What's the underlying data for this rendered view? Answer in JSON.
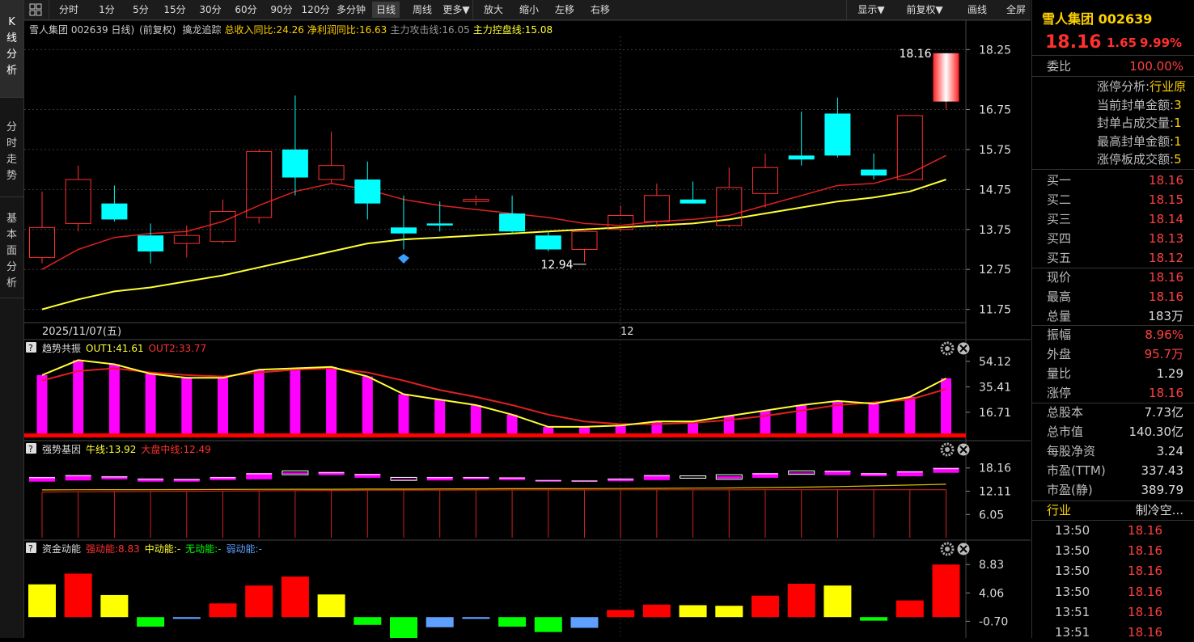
{
  "left_nav": [
    {
      "label": "K线分析",
      "chars": [
        "K",
        "线",
        "分",
        "析"
      ]
    },
    {
      "label": "分时走势",
      "chars": [
        "分",
        "时",
        "走",
        "势"
      ]
    },
    {
      "label": "基本面分析",
      "chars": [
        "基",
        "本",
        "面",
        "分",
        "析"
      ]
    }
  ],
  "toolbar": {
    "periods": [
      "分时",
      "1分",
      "5分",
      "15分",
      "30分",
      "60分",
      "90分",
      "120分",
      "多分钟",
      "日线",
      "周线",
      "更多▼"
    ],
    "active_period": "日线",
    "actions": [
      "放大",
      "缩小",
      "左移",
      "右移"
    ],
    "right_actions": [
      "显示▼",
      "前复权▼",
      "画线",
      "全屏"
    ]
  },
  "main_chart": {
    "title": "雪人集团 002639 日线)",
    "adjust": "(前复权)",
    "indicator": "擒龙追踪",
    "rev_label": "总收入同比:24.26",
    "profit_label": "净利润同比:16.63",
    "attack_label": "主力攻击线:16.05",
    "control_label": "主力控盘线:15.08",
    "y_ticks": [
      "18.25",
      "16.75",
      "15.75",
      "14.75",
      "13.75",
      "12.75",
      "11.75"
    ],
    "date_label": "2025/11/07(五)",
    "month_label": "12",
    "high_label": "18.16",
    "low_label": "12.94"
  },
  "chart_data": [
    {
      "type": "candlestick",
      "y_range": [
        11.5,
        18.5
      ],
      "candles": [
        {
          "o": 13.05,
          "c": 13.8,
          "h": 14.7,
          "l": 12.9,
          "up": true
        },
        {
          "o": 13.9,
          "c": 15.0,
          "h": 15.35,
          "l": 13.7,
          "up": true
        },
        {
          "o": 14.4,
          "c": 14.0,
          "h": 14.85,
          "l": 13.95,
          "up": false
        },
        {
          "o": 13.6,
          "c": 13.2,
          "h": 13.9,
          "l": 12.9,
          "up": false
        },
        {
          "o": 13.4,
          "c": 13.6,
          "h": 13.85,
          "l": 13.05,
          "up": true
        },
        {
          "o": 13.45,
          "c": 14.2,
          "h": 14.5,
          "l": 13.4,
          "up": true
        },
        {
          "o": 14.05,
          "c": 15.7,
          "h": 15.75,
          "l": 13.9,
          "up": true
        },
        {
          "o": 15.75,
          "c": 15.05,
          "h": 17.1,
          "l": 14.6,
          "up": false
        },
        {
          "o": 15.0,
          "c": 15.35,
          "h": 16.2,
          "l": 14.9,
          "up": true
        },
        {
          "o": 15.0,
          "c": 14.4,
          "h": 15.45,
          "l": 14.0,
          "up": false
        },
        {
          "o": 13.8,
          "c": 13.65,
          "h": 14.6,
          "l": 13.25,
          "up": false
        },
        {
          "o": 13.85,
          "c": 13.9,
          "h": 14.45,
          "l": 13.7,
          "up": false
        },
        {
          "o": 14.5,
          "c": 14.45,
          "h": 14.6,
          "l": 14.35,
          "up": true
        },
        {
          "o": 14.15,
          "c": 13.7,
          "h": 14.6,
          "l": 13.65,
          "up": false
        },
        {
          "o": 13.6,
          "c": 13.25,
          "h": 13.7,
          "l": 13.2,
          "up": false
        },
        {
          "o": 13.25,
          "c": 13.7,
          "h": 13.75,
          "l": 12.94,
          "up": true
        },
        {
          "o": 13.75,
          "c": 14.1,
          "h": 14.35,
          "l": 13.7,
          "up": true
        },
        {
          "o": 13.95,
          "c": 14.6,
          "h": 14.9,
          "l": 13.8,
          "up": true
        },
        {
          "o": 14.5,
          "c": 14.4,
          "h": 14.95,
          "l": 14.4,
          "up": false
        },
        {
          "o": 13.85,
          "c": 14.8,
          "h": 15.3,
          "l": 13.8,
          "up": true
        },
        {
          "o": 14.65,
          "c": 15.3,
          "h": 15.65,
          "l": 14.3,
          "up": true
        },
        {
          "o": 15.6,
          "c": 15.5,
          "h": 16.7,
          "l": 15.35,
          "up": false
        },
        {
          "o": 16.65,
          "c": 15.6,
          "h": 17.05,
          "l": 15.55,
          "up": false
        },
        {
          "o": 15.25,
          "c": 15.1,
          "h": 15.65,
          "l": 15.0,
          "up": false
        },
        {
          "o": 15.0,
          "c": 16.6,
          "h": 16.6,
          "l": 15.0,
          "up": true
        },
        {
          "o": 16.95,
          "c": 18.16,
          "h": 18.16,
          "l": 16.75,
          "up": true
        }
      ],
      "attack_line": [
        12.75,
        13.25,
        13.55,
        13.65,
        13.7,
        13.95,
        14.35,
        14.7,
        14.9,
        14.75,
        14.5,
        14.35,
        14.25,
        14.15,
        14.05,
        13.9,
        13.85,
        13.95,
        14.0,
        14.1,
        14.35,
        14.6,
        14.85,
        14.9,
        15.15,
        15.6
      ],
      "control_line": [
        11.75,
        12.0,
        12.2,
        12.3,
        12.45,
        12.6,
        12.8,
        13.0,
        13.2,
        13.4,
        13.5,
        13.55,
        13.6,
        13.65,
        13.7,
        13.75,
        13.8,
        13.85,
        13.9,
        14.0,
        14.15,
        14.3,
        14.45,
        14.55,
        14.7,
        15.0
      ]
    },
    {
      "type": "bar",
      "title": "趋势共振",
      "out1_label": "OUT1:41.61",
      "out2_label": "OUT2:33.77",
      "y_ticks": [
        "54.12",
        "35.41",
        "16.71"
      ],
      "y_range": [
        0,
        60
      ],
      "values": [
        44,
        55,
        52,
        45,
        42,
        42,
        48,
        49,
        50,
        43,
        30,
        26,
        22,
        15,
        6,
        6,
        7,
        10,
        10,
        14,
        18,
        22,
        25,
        23,
        28,
        41.61
      ],
      "out1_line": [
        44,
        55,
        52,
        45,
        42,
        42,
        48,
        49,
        50,
        43,
        30,
        26,
        22,
        15,
        6,
        6,
        7,
        10,
        10,
        14,
        18,
        22,
        25,
        23,
        28,
        41.61
      ],
      "out2_line": [
        40,
        47,
        49,
        46,
        44,
        43,
        46,
        48,
        49,
        46,
        40,
        33,
        28,
        22,
        15,
        10,
        8,
        8,
        9,
        11,
        14,
        18,
        22,
        24,
        26,
        33.77
      ]
    },
    {
      "type": "bar",
      "title": "强势基因",
      "bull_label": "牛线:13.92",
      "market_label": "大盘中线:12.49",
      "y_ticks": [
        "18.16",
        "12.11",
        "6.05"
      ],
      "y_range": [
        0,
        20
      ],
      "boxes": [
        {
          "top": 15.8,
          "bottom": 14.6,
          "hollow": false
        },
        {
          "top": 16.3,
          "bottom": 14.9,
          "hollow": false
        },
        {
          "top": 16.0,
          "bottom": 15.2,
          "hollow": false
        },
        {
          "top": 15.4,
          "bottom": 14.6,
          "hollow": false
        },
        {
          "top": 15.3,
          "bottom": 14.6,
          "hollow": false
        },
        {
          "top": 15.8,
          "bottom": 15.0,
          "hollow": false
        },
        {
          "top": 16.8,
          "bottom": 15.2,
          "hollow": false
        },
        {
          "top": 17.4,
          "bottom": 16.4,
          "hollow": true
        },
        {
          "top": 17.1,
          "bottom": 16.3,
          "hollow": false
        },
        {
          "top": 16.6,
          "bottom": 15.6,
          "hollow": false
        },
        {
          "top": 15.7,
          "bottom": 14.9,
          "hollow": true
        },
        {
          "top": 15.8,
          "bottom": 14.9,
          "hollow": false
        },
        {
          "top": 15.8,
          "bottom": 15.2,
          "hollow": false
        },
        {
          "top": 15.7,
          "bottom": 15.0,
          "hollow": false
        },
        {
          "top": 15.0,
          "bottom": 14.6,
          "hollow": false
        },
        {
          "top": 14.9,
          "bottom": 14.6,
          "hollow": false
        },
        {
          "top": 15.4,
          "bottom": 14.7,
          "hollow": false
        },
        {
          "top": 16.3,
          "bottom": 15.0,
          "hollow": false
        },
        {
          "top": 16.1,
          "bottom": 15.5,
          "hollow": true
        },
        {
          "top": 16.4,
          "bottom": 15.2,
          "hollow": true
        },
        {
          "top": 16.8,
          "bottom": 15.6,
          "hollow": false
        },
        {
          "top": 17.4,
          "bottom": 16.5,
          "hollow": true
        },
        {
          "top": 17.4,
          "bottom": 16.3,
          "hollow": false
        },
        {
          "top": 16.8,
          "bottom": 16.0,
          "hollow": false
        },
        {
          "top": 17.3,
          "bottom": 16.0,
          "hollow": false
        },
        {
          "top": 18.16,
          "bottom": 16.9,
          "hollow": false
        }
      ],
      "bull_line": [
        12.45,
        12.48,
        12.5,
        12.5,
        12.52,
        12.55,
        12.58,
        12.6,
        12.62,
        12.65,
        12.65,
        12.7,
        12.72,
        12.75,
        12.75,
        12.78,
        12.8,
        12.85,
        12.9,
        12.95,
        13.05,
        13.15,
        13.3,
        13.5,
        13.7,
        13.92
      ],
      "market_line": [
        11.9,
        11.95,
        12.0,
        12.05,
        12.1,
        12.15,
        12.2,
        12.25,
        12.3,
        12.35,
        12.38,
        12.4,
        12.42,
        12.44,
        12.45,
        12.45,
        12.46,
        12.46,
        12.47,
        12.47,
        12.48,
        12.48,
        12.48,
        12.49,
        12.49,
        12.49
      ]
    },
    {
      "type": "bar",
      "title": "资金动能",
      "strong_label": "强动能:8.83",
      "mid_label": "中动能:-",
      "none_label": "无动能:-",
      "weak_label": "弱动能:-",
      "y_ticks": [
        "8.83",
        "4.06",
        "-0.70"
      ],
      "y_range": [
        -3.5,
        9.8
      ],
      "values": [
        5.5,
        7.3,
        3.7,
        -1.6,
        -0.3,
        2.3,
        5.3,
        6.8,
        3.8,
        -1.3,
        -3.5,
        -1.7,
        -0.3,
        -1.6,
        -2.5,
        -1.8,
        1.2,
        2.1,
        2.0,
        1.9,
        3.6,
        5.6,
        5.3,
        -0.6,
        2.8,
        8.83
      ],
      "colors": [
        "yellow",
        "red",
        "yellow",
        "green",
        "blue",
        "red",
        "red",
        "red",
        "yellow",
        "green",
        "green",
        "blue",
        "blue",
        "green",
        "green",
        "blue",
        "red",
        "red",
        "yellow",
        "yellow",
        "red",
        "red",
        "yellow",
        "green",
        "red",
        "red"
      ]
    }
  ],
  "right_panel": {
    "stock_title": "雪人集团 002639",
    "price": "18.16",
    "change": "1.65",
    "change_pct": "9.99%",
    "weibi_label": "委比",
    "weibi_value": "100.00%",
    "info_lines": [
      {
        "label": "涨停分析:",
        "value": "行业原"
      },
      {
        "label": "当前封单金额:",
        "value": "3"
      },
      {
        "label": "封单占成交量:",
        "value": "1"
      },
      {
        "label": "最高封单金额:",
        "value": "1"
      },
      {
        "label": "涨停板成交额:",
        "value": "5"
      }
    ],
    "bids": [
      {
        "label": "买一",
        "value": "18.16"
      },
      {
        "label": "买二",
        "value": "18.15"
      },
      {
        "label": "买三",
        "value": "18.14"
      },
      {
        "label": "买四",
        "value": "18.13"
      },
      {
        "label": "买五",
        "value": "18.12"
      }
    ],
    "quote1": [
      {
        "label": "现价",
        "value": "18.16",
        "white": false
      },
      {
        "label": "最高",
        "value": "18.16",
        "white": false
      },
      {
        "label": "总量",
        "value": "183万",
        "white": true
      }
    ],
    "quote2": [
      {
        "label": "振幅",
        "value": "8.96%",
        "white": false
      },
      {
        "label": "外盘",
        "value": "95.7万",
        "white": false
      },
      {
        "label": "量比",
        "value": "1.29",
        "white": true
      },
      {
        "label": "涨停",
        "value": "18.16",
        "white": false
      }
    ],
    "fundamentals": [
      {
        "label": "总股本",
        "value": "7.73亿"
      },
      {
        "label": "总市值",
        "value": "140.30亿"
      },
      {
        "label": "每股净资",
        "value": "3.24"
      },
      {
        "label": "市盈(TTM)",
        "value": "337.43"
      },
      {
        "label": "市盈(静)",
        "value": "389.79"
      }
    ],
    "industry_label": "行业",
    "industry_value": "制冷空...",
    "ticks": [
      {
        "time": "13:50",
        "price": "18.16"
      },
      {
        "time": "13:50",
        "price": "18.16"
      },
      {
        "time": "13:50",
        "price": "18.16"
      },
      {
        "time": "13:50",
        "price": "18.16"
      },
      {
        "time": "13:51",
        "price": "18.16"
      },
      {
        "time": "13:51",
        "price": "18.16"
      }
    ]
  },
  "colors": {
    "up": "#ff3030",
    "down_fill": "#00ffff",
    "attack": "#e02020",
    "control": "#ffff33",
    "magenta": "#ff00ff",
    "yellow": "#ffff00",
    "green": "#00ff00",
    "blue": "#5f9fff"
  }
}
